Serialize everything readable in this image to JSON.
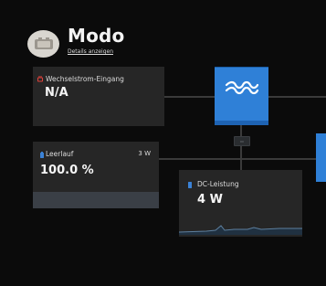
{
  "header": {
    "title": "Modo",
    "details_link": "Details anzeigen",
    "mode_icon": "generator-icon"
  },
  "ac_input": {
    "label": "Wechselstrom-Eingang",
    "value": "N/A",
    "icon": "plug-icon",
    "icon_color": "#e0413b"
  },
  "battery": {
    "label": "Leerlauf",
    "power": "3 W",
    "value": "100.0 %",
    "icon": "battery-icon",
    "icon_color": "#3b82d6",
    "fill_percent": 100
  },
  "dc_power": {
    "label": "DC-Leistung",
    "value": "4 W",
    "icon": "dc-icon",
    "icon_color": "#3b82d6"
  },
  "inverter": {
    "logo": "victron-wave-logo",
    "color": "#2f80d7"
  }
}
